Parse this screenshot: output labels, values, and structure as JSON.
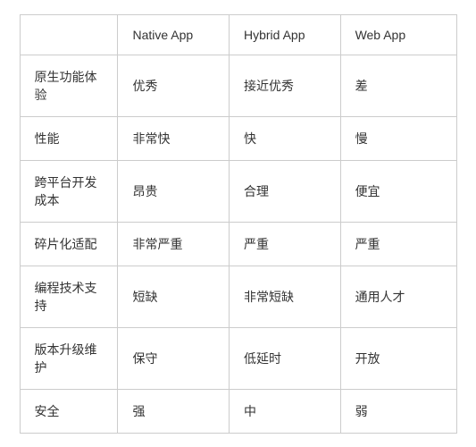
{
  "table": {
    "headers": {
      "feature": "",
      "native": "Native App",
      "hybrid": "Hybrid App",
      "web": "Web App"
    },
    "rows": [
      {
        "feature": "原生功能体验",
        "native": "优秀",
        "hybrid": "接近优秀",
        "web": "差"
      },
      {
        "feature": "性能",
        "native": "非常快",
        "hybrid": "快",
        "web": "慢"
      },
      {
        "feature": "跨平台开发成本",
        "native": "昂贵",
        "hybrid": "合理",
        "web": "便宜"
      },
      {
        "feature": "碎片化适配",
        "native": "非常严重",
        "hybrid": "严重",
        "web": "严重"
      },
      {
        "feature": "编程技术支持",
        "native": "短缺",
        "hybrid": "非常短缺",
        "web": "通用人才"
      },
      {
        "feature": "版本升级维护",
        "native": "保守",
        "hybrid": "低延时",
        "web": "开放"
      },
      {
        "feature": "安全",
        "native": "强",
        "hybrid": "中",
        "web": "弱"
      }
    ]
  }
}
